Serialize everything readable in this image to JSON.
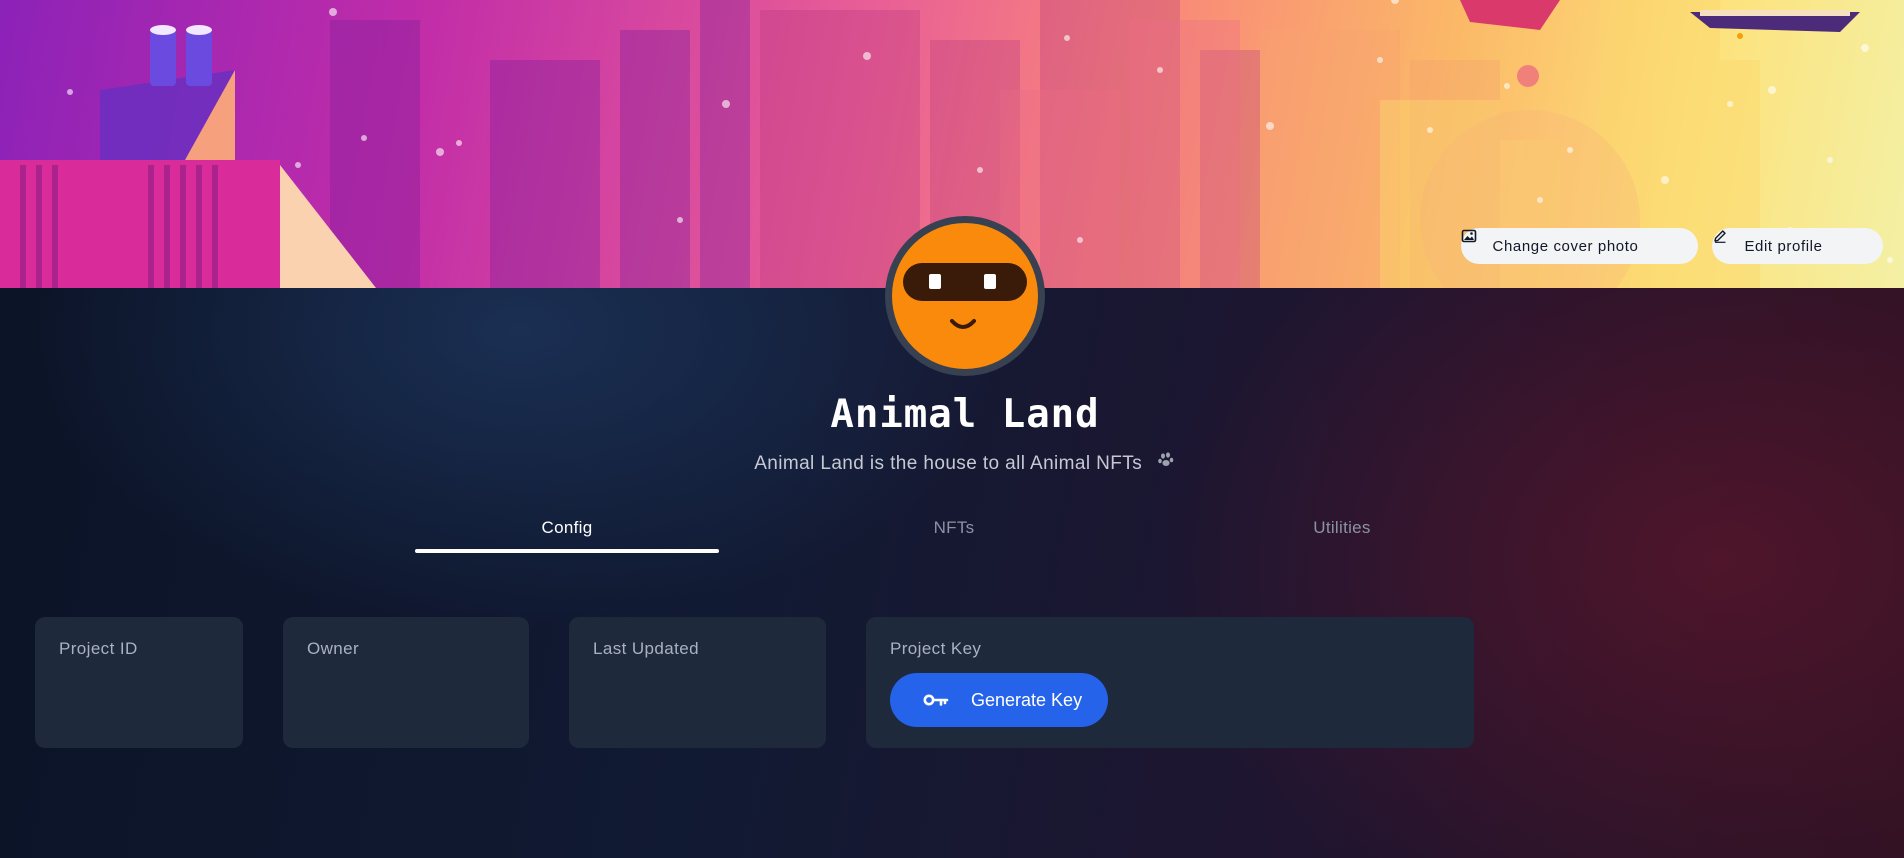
{
  "cover": {
    "change_cover_label": "Change cover photo",
    "change_cover_icon": "image-icon",
    "edit_profile_label": "Edit profile",
    "edit_profile_icon": "pencil-icon"
  },
  "profile": {
    "name": "Animal Land",
    "description": "Animal Land is the house to all Animal NFTs",
    "description_icon": "paw-icon",
    "avatar": "masked-smiley-face"
  },
  "tabs": [
    {
      "label": "Config",
      "active": true
    },
    {
      "label": "NFTs",
      "active": false
    },
    {
      "label": "Utilities",
      "active": false
    }
  ],
  "cards": {
    "project_id": {
      "label": "Project ID",
      "value": ""
    },
    "owner": {
      "label": "Owner",
      "value": ""
    },
    "last_updated": {
      "label": "Last Updated",
      "value": ""
    },
    "project_key": {
      "label": "Project Key",
      "button_label": "Generate Key",
      "button_icon": "key-icon"
    }
  },
  "colors": {
    "accent": "#2563eb",
    "card_bg": "#1e293b",
    "avatar_bg": "#f98a0b",
    "page_bg": "#0b1226"
  }
}
